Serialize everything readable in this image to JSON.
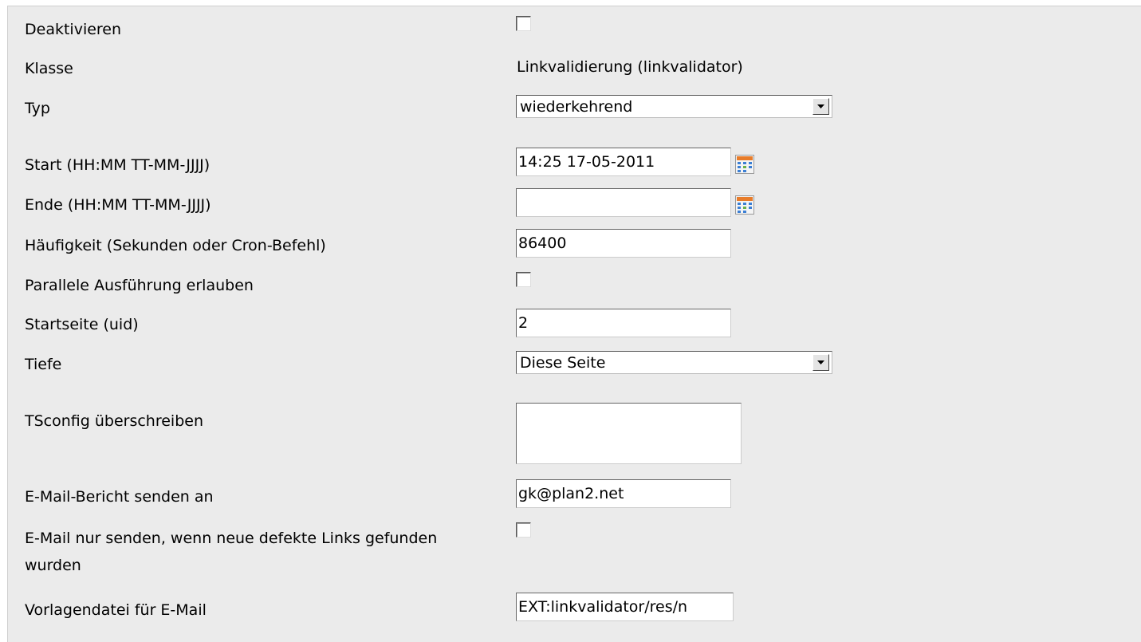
{
  "form": {
    "deactivate": {
      "label": "Deaktivieren",
      "checked": false
    },
    "class": {
      "label": "Klasse",
      "value": "Linkvalidierung (linkvalidator)"
    },
    "type": {
      "label": "Typ",
      "value": "wiederkehrend"
    },
    "start": {
      "label": "Start (HH:MM TT-MM-JJJJ)",
      "value": "14:25 17-05-2011",
      "icon": "calendar-icon"
    },
    "end": {
      "label": "Ende (HH:MM TT-MM-JJJJ)",
      "value": "",
      "icon": "calendar-icon"
    },
    "frequency": {
      "label": "Häufigkeit (Sekunden oder Cron-Befehl)",
      "value": "86400"
    },
    "parallel": {
      "label": "Parallele Ausführung erlauben",
      "checked": false
    },
    "start_page": {
      "label": "Startseite (uid)",
      "value": "2"
    },
    "depth": {
      "label": "Tiefe",
      "value": "Diese Seite"
    },
    "tsconfig": {
      "label": "TSconfig überschreiben",
      "value": ""
    },
    "email_report": {
      "label": "E-Mail-Bericht senden an",
      "value": "gk@plan2.net"
    },
    "email_only_new": {
      "label": "E-Mail nur senden, wenn neue defekte Links gefunden wurden",
      "checked": false
    },
    "template_file": {
      "label": "Vorlagendatei für E-Mail",
      "value": "EXT:linkvalidator/res/n"
    }
  },
  "colors": {
    "panel_background": "#ebebeb",
    "field_background": "#ffffff",
    "calendar_header": "#e87c2a",
    "calendar_cells": "#3b7fd4"
  }
}
